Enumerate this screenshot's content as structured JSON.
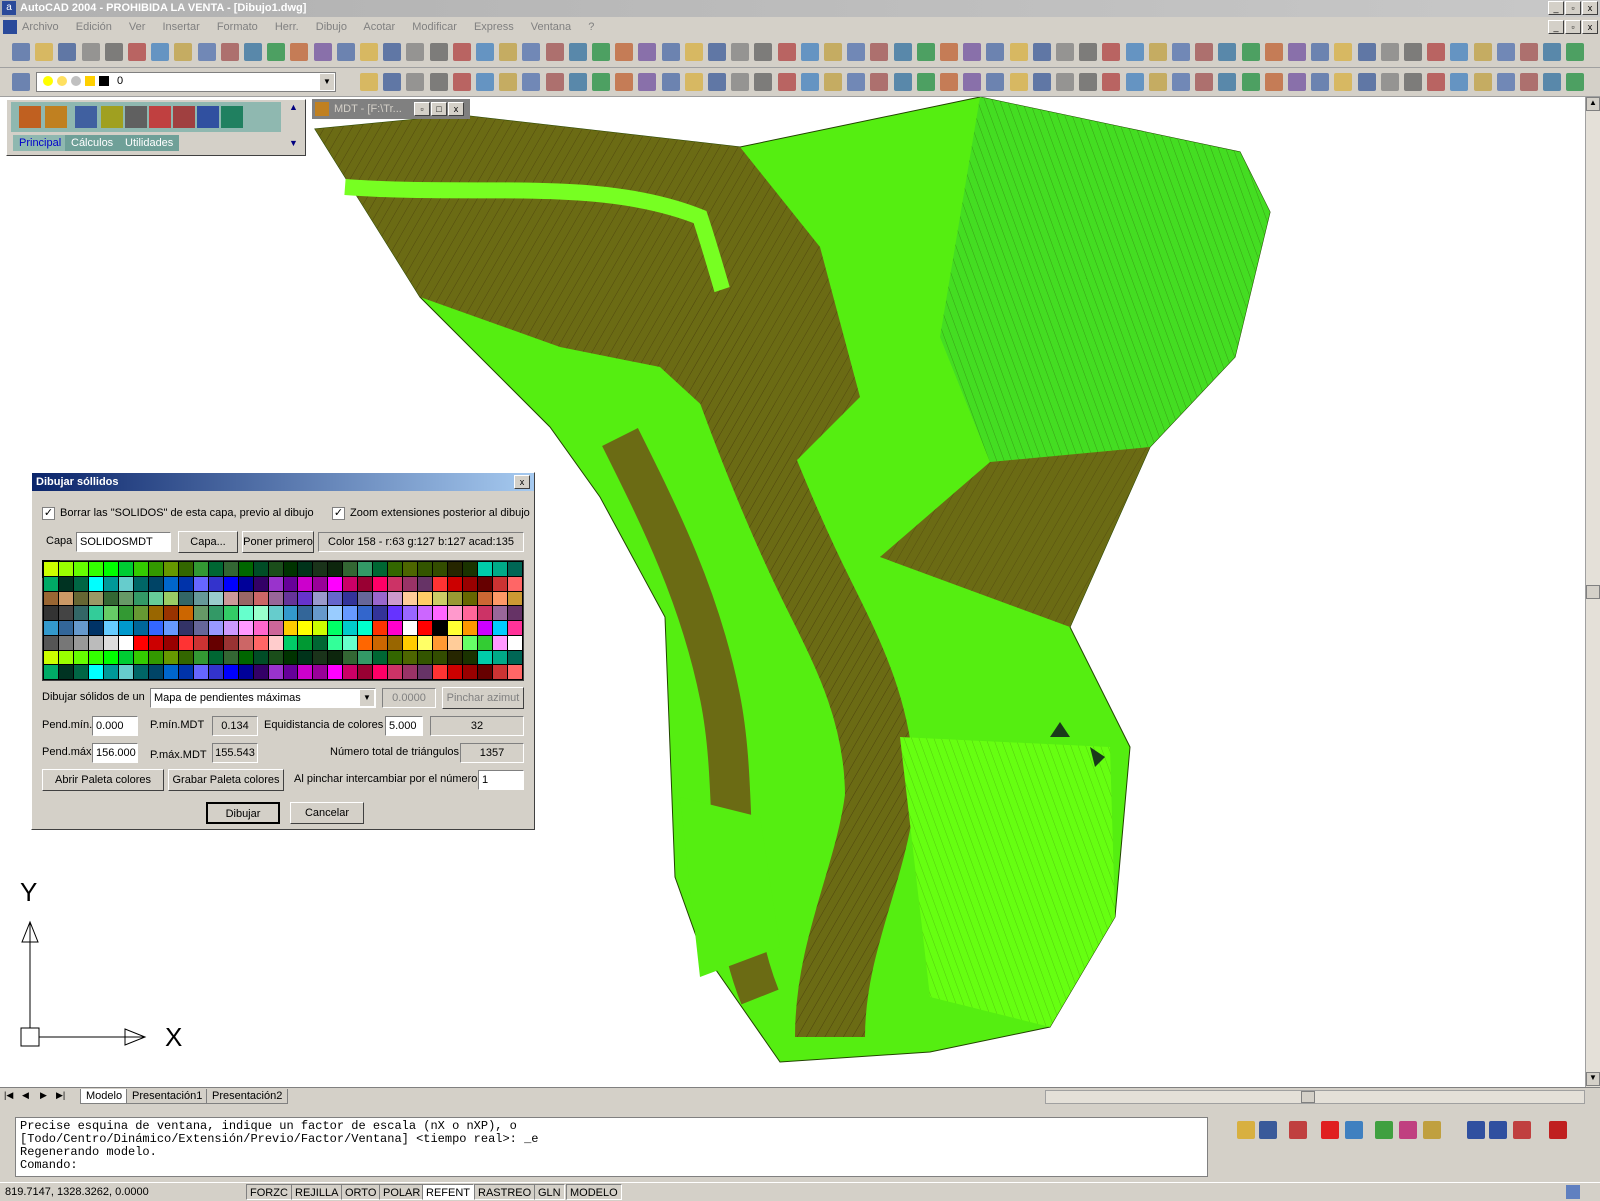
{
  "window": {
    "title": "AutoCAD 2004 - PROHIBIDA LA VENTA - [Dibujo1.dwg]",
    "buttons": [
      "_",
      "▫",
      "x"
    ]
  },
  "menu": [
    "Archivo",
    "Edición",
    "Ver",
    "Insertar",
    "Formato",
    "Herr.",
    "Dibujo",
    "Acotar",
    "Modificar",
    "Express",
    "Ventana",
    "?"
  ],
  "layer_toolbar": {
    "layer_name": "0"
  },
  "plugin_toolbar": {
    "tabs": [
      "Principal",
      "Cálculos",
      "Utilidades"
    ]
  },
  "mdt_window": {
    "title": "MDT - [F:\\Tr..."
  },
  "dialog": {
    "title": "Dibujar sóllidos",
    "check_borrar": "Borrar las \"SOLIDOS\" de esta capa, previo al dibujo",
    "check_zoom": "Zoom extensiones posterior al dibujo",
    "capa_label": "Capa",
    "capa_value": "SOLIDOSMDT",
    "capa_button": "Capa...",
    "poner_primero_button": "Poner primero",
    "color_info": "Color 158 - r:63 g:127 b:127 acad:135",
    "dibujar_label": "Dibujar sólidos de un",
    "dibujar_select": "Mapa de pendientes máximas",
    "azimut_value": "0.0000",
    "pinchar_azimut_button": "Pinchar azimut",
    "pend_min_label": "Pend.mín.",
    "pend_min_value": "0.000",
    "pmin_mdt_label": "P.mín.MDT",
    "pmin_mdt_value": "0.134",
    "equidistancia_label": "Equidistancia de colores",
    "equidistancia_value": "5.000",
    "equidistancia_count": "32",
    "pend_max_label": "Pend.máx",
    "pend_max_value": "156.000",
    "pmax_mdt_label": "P.máx.MDT",
    "pmax_mdt_value": "155.543",
    "triangulos_label": "Número total de triángulos",
    "triangulos_value": "1357",
    "abrir_paleta_button": "Abrir Paleta colores",
    "grabar_paleta_button": "Grabar Paleta colores",
    "intercambiar_label": "Al pinchar intercambiar por el número",
    "intercambiar_value": "1",
    "dibujar_button": "Dibujar",
    "cancelar_button": "Cancelar"
  },
  "ucs": {
    "x_label": "X",
    "y_label": "Y"
  },
  "layout_tabs": [
    "Modelo",
    "Presentación1",
    "Presentación2"
  ],
  "command_lines": [
    "Precise esquina de ventana, indique un factor de escala (nX o nXP), o",
    "[Todo/Centro/Dinámico/Extensión/Previo/Factor/Ventana] <tiempo real>: _e",
    "Regenerando modelo.",
    "Comando:"
  ],
  "status": {
    "coords": "819.7147, 1328.3262, 0.0000",
    "modes": [
      "FORZC",
      "REJILLA",
      "ORTO",
      "POLAR",
      "REFENT",
      "RASTREO",
      "GLN",
      "MODELO"
    ]
  },
  "colors": {
    "terrain_light": "#66ff00",
    "terrain_dark": "#6b6b14",
    "terrain_mid": "#33cc22"
  }
}
